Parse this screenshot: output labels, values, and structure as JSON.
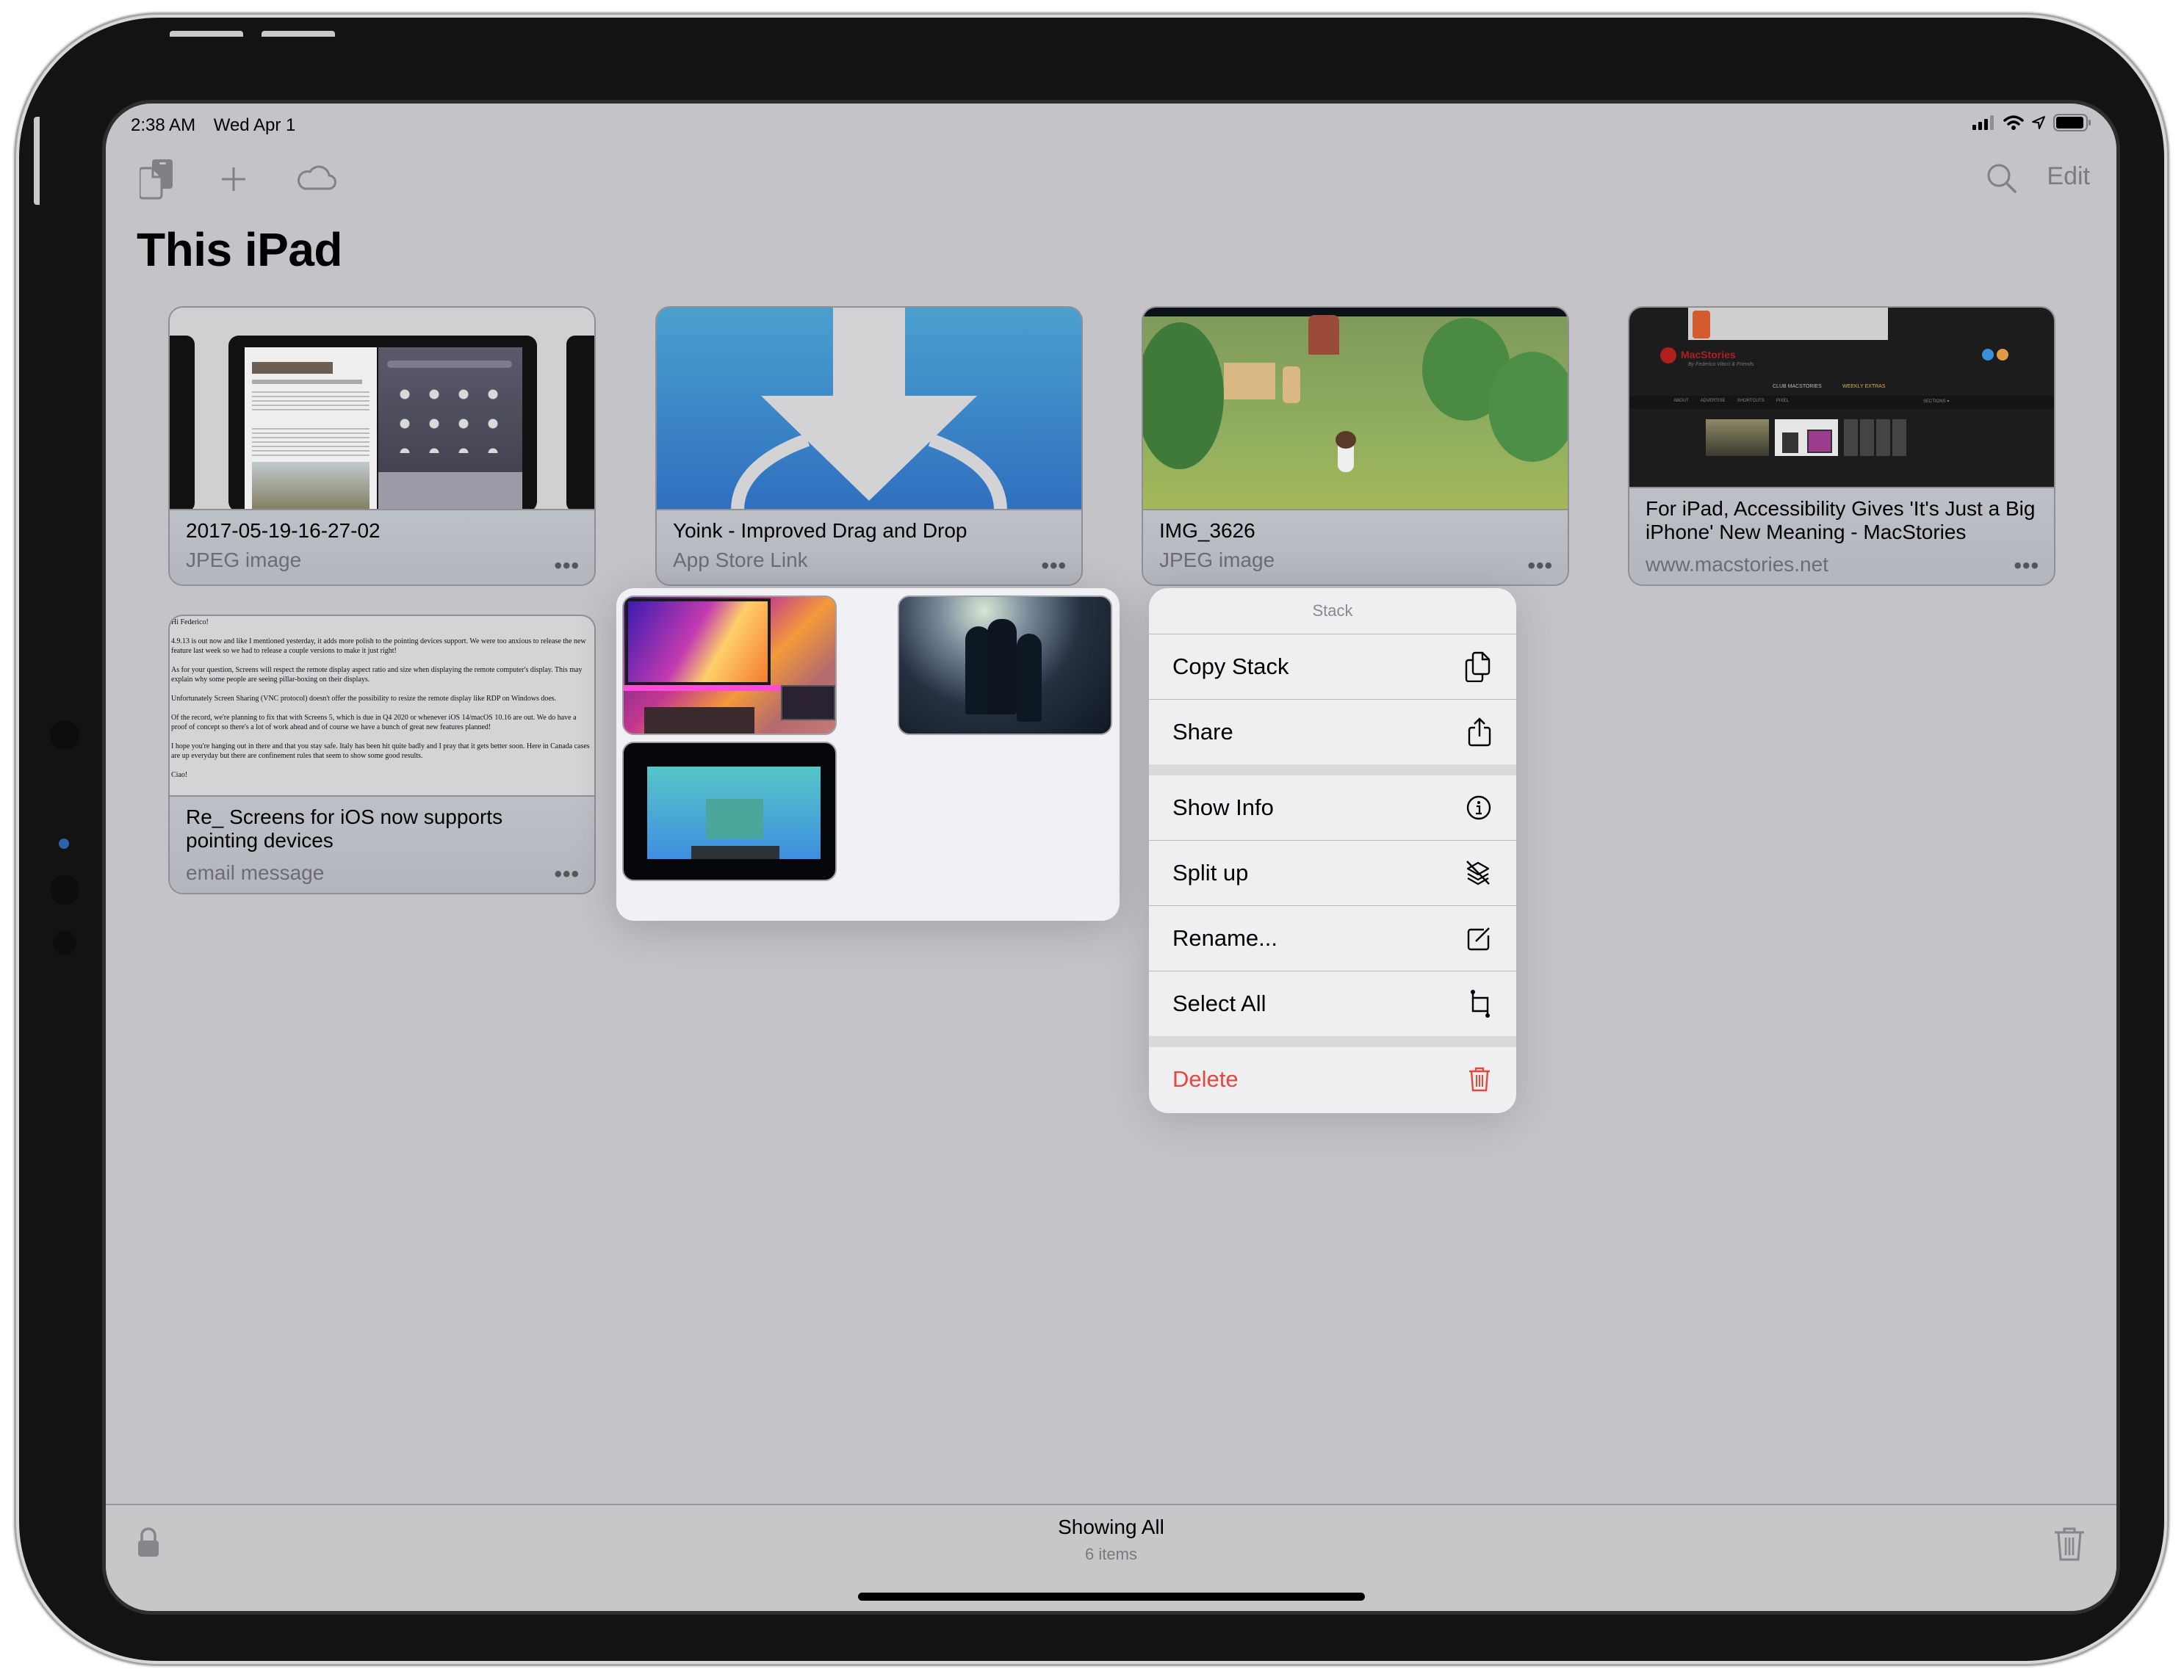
{
  "status_bar": {
    "time": "2:38 AM",
    "date": "Wed Apr 1",
    "icons": [
      "cellular-signal-icon",
      "wifi-icon",
      "location-arrow-icon",
      "battery-icon"
    ]
  },
  "toolbar": {
    "left_icons": [
      "devices-icon",
      "plus-icon",
      "cloud-icon"
    ],
    "right_icons": [
      "search-icon"
    ],
    "edit_label": "Edit"
  },
  "page_title": "This iPad",
  "items": [
    {
      "title": "2017-05-19-16-27-02",
      "subtitle": "JPEG image",
      "thumb": "ipad-screenshot"
    },
    {
      "title": "Yoink - Improved Drag and Drop",
      "subtitle": "App Store Link",
      "thumb": "yoink-app-icon"
    },
    {
      "title": "IMG_3626",
      "subtitle": "JPEG image",
      "thumb": "game-screenshot"
    },
    {
      "title": "For iPad, Accessibility Gives 'It's Just a Big iPhone' New Meaning - MacStories",
      "subtitle": "www.macstories.net",
      "thumb": "webpage-preview"
    },
    {
      "title": "Re_ Screens for iOS now supports pointing devices",
      "subtitle": "email message",
      "thumb": "email-preview"
    }
  ],
  "more_glyph": "•••",
  "email_preview": {
    "lines": [
      "Hi Federico!",
      "4.9.13 is out now and like I mentioned yesterday, it adds more polish to the pointing devices support. We were too anxious to release the new feature last week so we had to release a couple versions to make it just right!",
      "As for your question, Screens will respect the remote display aspect ratio and size when displaying the remote computer's display. This may explain why some people are seeing pillar-boxing on their displays.",
      "Unfortunately Screen Sharing (VNC protocol) doesn't offer the possibility to resize the remote display like RDP on Windows does.",
      "Of the record, we're planning to fix that with Screens 5, which is due in Q4 2020 or whenever iOS 14/macOS 10.16 are out. We do have a proof of concept so there's a lot of work ahead and of course we have a bunch of great new features planned!",
      "I hope you're hanging out in there and that you stay safe. Italy has been hit quite badly and I pray that it gets better soon. Here in Canada cases are up everyday but there are confinement rules that seem to show some good results.",
      "Ciao!"
    ]
  },
  "webpage_preview": {
    "site_name": "MacStories",
    "byline": "By Federico Viticci & Friends",
    "club": "CLUB MACSTORIES",
    "extras": "WEEKLY EXTRAS",
    "nav": [
      "ABOUT",
      "ADVERTISE",
      "SHORTCUTS",
      "PIXEL"
    ],
    "sections": "SECTIONS ▾"
  },
  "stack_preview": {
    "thumbs": [
      "desk-setup-photo",
      "space-artwork",
      "game-rank-max-photo"
    ]
  },
  "context_menu": {
    "header": "Stack",
    "groups": [
      [
        {
          "label": "Copy Stack",
          "icon": "copy-icon"
        },
        {
          "label": "Share",
          "icon": "share-icon"
        }
      ],
      [
        {
          "label": "Show Info",
          "icon": "info-icon"
        },
        {
          "label": "Split up",
          "icon": "split-layers-icon"
        },
        {
          "label": "Rename...",
          "icon": "rename-icon"
        },
        {
          "label": "Select All",
          "icon": "select-all-icon"
        }
      ],
      [
        {
          "label": "Delete",
          "icon": "trash-icon",
          "destructive": true
        }
      ]
    ]
  },
  "bottom_bar": {
    "title": "Showing All",
    "subtitle": "6 items",
    "left_icon": "lock-icon",
    "right_icon": "trash-icon"
  },
  "colors": {
    "destructive": "#e5473c",
    "yoink_blue": "#3a8fd0",
    "background": "#c4c3c8"
  }
}
